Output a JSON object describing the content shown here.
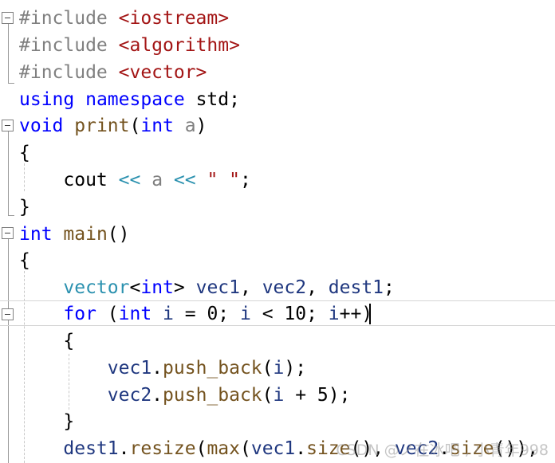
{
  "editor": {
    "lines": [
      [
        {
          "t": "#include ",
          "c": "macro"
        },
        {
          "t": "<iostream>",
          "c": "str"
        }
      ],
      [
        {
          "t": "#include ",
          "c": "macro"
        },
        {
          "t": "<algorithm>",
          "c": "str"
        }
      ],
      [
        {
          "t": "#include ",
          "c": "macro"
        },
        {
          "t": "<vector>",
          "c": "str"
        }
      ],
      [
        {
          "t": "using",
          "c": "kw"
        },
        {
          "t": " ",
          "c": "plain"
        },
        {
          "t": "namespace",
          "c": "kw"
        },
        {
          "t": " std;",
          "c": "plain"
        }
      ],
      [
        {
          "t": "void",
          "c": "kw"
        },
        {
          "t": " ",
          "c": "plain"
        },
        {
          "t": "print",
          "c": "fn"
        },
        {
          "t": "(",
          "c": "plain"
        },
        {
          "t": "int",
          "c": "kw"
        },
        {
          "t": " ",
          "c": "plain"
        },
        {
          "t": "a",
          "c": "param"
        },
        {
          "t": ")",
          "c": "plain"
        }
      ],
      [
        {
          "t": "{",
          "c": "plain"
        }
      ],
      [
        {
          "t": "    cout ",
          "c": "plain"
        },
        {
          "t": "<<",
          "c": "type"
        },
        {
          "t": " ",
          "c": "plain"
        },
        {
          "t": "a",
          "c": "param"
        },
        {
          "t": " ",
          "c": "plain"
        },
        {
          "t": "<<",
          "c": "type"
        },
        {
          "t": " ",
          "c": "plain"
        },
        {
          "t": "\" \"",
          "c": "str"
        },
        {
          "t": ";",
          "c": "plain"
        }
      ],
      [
        {
          "t": "}",
          "c": "plain"
        }
      ],
      [
        {
          "t": "int",
          "c": "kw"
        },
        {
          "t": " ",
          "c": "plain"
        },
        {
          "t": "main",
          "c": "fn"
        },
        {
          "t": "()",
          "c": "plain"
        }
      ],
      [
        {
          "t": "{",
          "c": "plain"
        }
      ],
      [
        {
          "t": "    ",
          "c": "plain"
        },
        {
          "t": "vector",
          "c": "type"
        },
        {
          "t": "<",
          "c": "plain"
        },
        {
          "t": "int",
          "c": "kw"
        },
        {
          "t": "> ",
          "c": "plain"
        },
        {
          "t": "vec1",
          "c": "var"
        },
        {
          "t": ", ",
          "c": "plain"
        },
        {
          "t": "vec2",
          "c": "var"
        },
        {
          "t": ", ",
          "c": "plain"
        },
        {
          "t": "dest1",
          "c": "var"
        },
        {
          "t": ";",
          "c": "plain"
        }
      ],
      [
        {
          "t": "    ",
          "c": "plain"
        },
        {
          "t": "for",
          "c": "kw"
        },
        {
          "t": " (",
          "c": "plain"
        },
        {
          "t": "int",
          "c": "kw"
        },
        {
          "t": " ",
          "c": "plain"
        },
        {
          "t": "i",
          "c": "var"
        },
        {
          "t": " = 0; ",
          "c": "plain"
        },
        {
          "t": "i",
          "c": "var"
        },
        {
          "t": " < 10; ",
          "c": "plain"
        },
        {
          "t": "i",
          "c": "var"
        },
        {
          "t": "++)",
          "c": "plain"
        }
      ],
      [
        {
          "t": "    {",
          "c": "plain"
        }
      ],
      [
        {
          "t": "        ",
          "c": "plain"
        },
        {
          "t": "vec1",
          "c": "var"
        },
        {
          "t": ".",
          "c": "plain"
        },
        {
          "t": "push_back",
          "c": "fn"
        },
        {
          "t": "(",
          "c": "plain"
        },
        {
          "t": "i",
          "c": "var"
        },
        {
          "t": ");",
          "c": "plain"
        }
      ],
      [
        {
          "t": "        ",
          "c": "plain"
        },
        {
          "t": "vec2",
          "c": "var"
        },
        {
          "t": ".",
          "c": "plain"
        },
        {
          "t": "push_back",
          "c": "fn"
        },
        {
          "t": "(",
          "c": "plain"
        },
        {
          "t": "i",
          "c": "var"
        },
        {
          "t": " + 5);",
          "c": "plain"
        }
      ],
      [
        {
          "t": "    }",
          "c": "plain"
        }
      ],
      [
        {
          "t": "    ",
          "c": "plain"
        },
        {
          "t": "dest1",
          "c": "var"
        },
        {
          "t": ".",
          "c": "plain"
        },
        {
          "t": "resize",
          "c": "fn"
        },
        {
          "t": "(",
          "c": "plain"
        },
        {
          "t": "max",
          "c": "fn"
        },
        {
          "t": "(",
          "c": "plain"
        },
        {
          "t": "vec1",
          "c": "var"
        },
        {
          "t": ".",
          "c": "plain"
        },
        {
          "t": "size",
          "c": "fn"
        },
        {
          "t": "(), ",
          "c": "plain"
        },
        {
          "t": "vec2",
          "c": "var"
        },
        {
          "t": ".",
          "c": "plain"
        },
        {
          "t": "size",
          "c": "fn"
        },
        {
          "t": "()),",
          "c": "plain"
        }
      ]
    ]
  },
  "watermark": "CSDN @ノ在冰吧 , 小青年998",
  "colors": {
    "keyword": "#0000ff",
    "type": "#2b91af",
    "string": "#a31515",
    "function": "#74531f",
    "variable": "#1f377f",
    "preprocessor": "#808080",
    "current_line_border": "#d6d6d6"
  }
}
